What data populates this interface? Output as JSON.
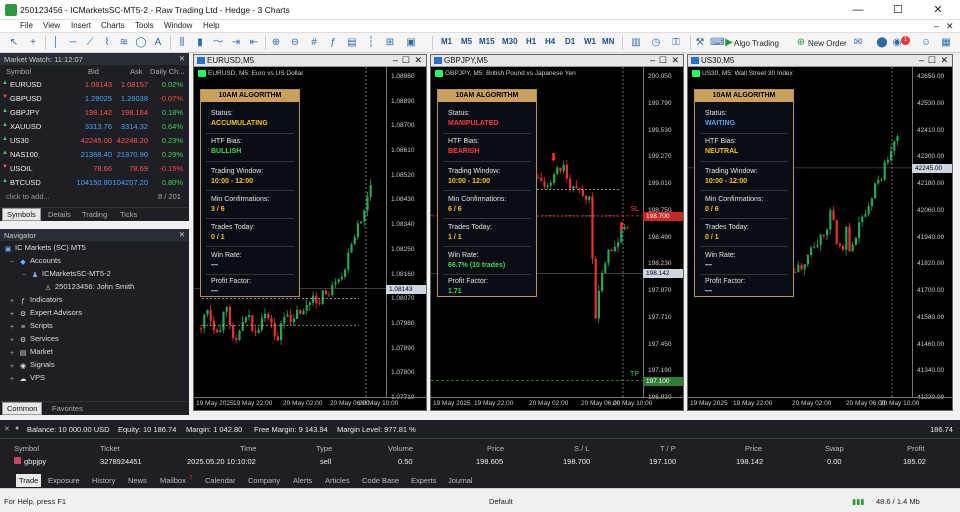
{
  "window": {
    "title": "250123456 - ICMarketsSC-MT5-2 - Raw Trading Ltd - Hedge - 3 Charts",
    "minimize": "—",
    "maximize": "☐",
    "close": "✕"
  },
  "menu": [
    "File",
    "View",
    "Insert",
    "Charts",
    "Tools",
    "Window",
    "Help"
  ],
  "toolbar": {
    "timeframes": [
      "M1",
      "M5",
      "M15",
      "M30",
      "H1",
      "H4",
      "D1",
      "W1",
      "MN"
    ],
    "algo_trading": "Algo Trading",
    "new_order": "New Order",
    "notifications": "1"
  },
  "market_watch": {
    "title": "Market Watch: 11:12:07",
    "headers": [
      "Symbol",
      "Bid",
      "Ask",
      "Daily Ch..."
    ],
    "rows": [
      {
        "symbol": "EURUSD",
        "bid": "1.08143",
        "ask": "1.08157",
        "change": "0.02%"
      },
      {
        "symbol": "GBPUSD",
        "bid": "1.29025",
        "ask": "1.29038",
        "change": "-0.07%"
      },
      {
        "symbol": "GBPJPY",
        "bid": "198.142",
        "ask": "198.164",
        "change": "0.18%"
      },
      {
        "symbol": "XAUUSD",
        "bid": "3313.76",
        "ask": "3314.32",
        "change": "0.64%"
      },
      {
        "symbol": "US30",
        "bid": "42245.00",
        "ask": "42248.20",
        "change": "0.23%"
      },
      {
        "symbol": "NAS100",
        "bid": "21368.40",
        "ask": "21370.90",
        "change": "0.29%"
      },
      {
        "symbol": "USOIL",
        "bid": "78.66",
        "ask": "78.69",
        "change": "-0.15%"
      },
      {
        "symbol": "BTCUSD",
        "bid": "104150.80",
        "ask": "104207.20",
        "change": "0.80%"
      }
    ],
    "add_text": "click to add...",
    "count": "8 / 201",
    "tabs": [
      "Symbols",
      "Details",
      "Trading",
      "Ticks"
    ]
  },
  "navigator": {
    "title": "Navigator",
    "items": [
      "IC Markets (SC) MT5",
      "Accounts",
      "ICMarketsSC-MT5-2",
      "250123456: John Smith",
      "Indicators",
      "Expert Advisors",
      "Scripts",
      "Services",
      "Market",
      "Signals",
      "VPS"
    ],
    "tabs": [
      "Common",
      "Favorites"
    ]
  },
  "charts": [
    {
      "window_title": "EURUSD,M5",
      "symbol_line": "EURUSD, M5:  Euro vs US Dollar",
      "prices": [
        "1.08980",
        "1.08890",
        "1.08700",
        "1.08610",
        "1.08520",
        "1.08430",
        "1.08340",
        "1.08250",
        "1.08160",
        "1.08070",
        "1.07980",
        "1.07890",
        "1.07800",
        "1.07710"
      ],
      "current": "1.08143",
      "times": [
        "19 May 2025",
        "19 May 22:00",
        "20 May 02:00",
        "20 May 06:00",
        "20 May 10:00"
      ],
      "status": "ACCUMULATING",
      "bias": "BULLISH",
      "window": "10:00 - 12:00",
      "confirm": "3 / 6",
      "trades": "0 / 1",
      "winrate": "—",
      "pf": "—"
    },
    {
      "window_title": "GBPJPY,M5",
      "symbol_line": "GBPJPY, M5:  British Pound vs Japanese Yen",
      "prices": [
        "200.050",
        "199.790",
        "199.530",
        "199.270",
        "199.010",
        "198.750",
        "198.490",
        "198.230",
        "197.970",
        "197.710",
        "197.450",
        "197.190",
        "196.930"
      ],
      "current": "198.142",
      "sl": "198.700",
      "tp": "197.100",
      "sl_label": "SL",
      "tp_label": "TP",
      "times": [
        "19 May 2025",
        "19 May 22:00",
        "20 May 02:00",
        "20 May 06:00",
        "20 May 10:00"
      ],
      "status": "MANIPULATED",
      "bias": "BEARISH",
      "window": "10:00 - 12:00",
      "confirm": "6 / 6",
      "trades": "1 / 1",
      "winrate": "66.7% (10 trades)",
      "pf": "1.71"
    },
    {
      "window_title": "US30,M5",
      "symbol_line": "US30, M5:  Wall Street 30 Index",
      "prices": [
        "42650.00",
        "42530.00",
        "42410.00",
        "42300.00",
        "42180.00",
        "42060.00",
        "41940.00",
        "41820.00",
        "41700.00",
        "41580.00",
        "41460.00",
        "41340.00",
        "41220.00"
      ],
      "current": "42245.00",
      "times": [
        "19 May 2025",
        "19 May 22:00",
        "20 May 02:00",
        "20 May 06:00",
        "20 May 10:00"
      ],
      "status": "WAITING",
      "bias": "NEUTRAL",
      "window": "10:00 - 12:00",
      "confirm": "0 / 6",
      "trades": "0 / 1",
      "winrate": "—",
      "pf": "—"
    }
  ],
  "algo_labels": {
    "header": "10AM ALGORITHM",
    "status": "Status:",
    "bias": "HTF Bias:",
    "window": "Trading Window:",
    "confirm": "Min Confirmations:",
    "trades": "Trades Today:",
    "winrate": "Win Rate:",
    "pf": "Profit Factor:"
  },
  "account": {
    "balance": "Balance: 10 000.00 USD",
    "equity": "Equity: 10 186.74",
    "margin": "Margin: 1 042.80",
    "free": "Free Margin: 9 143.94",
    "level": "Margin Level: 977.81 %",
    "profit_total": "186.74"
  },
  "trade": {
    "headers": [
      "Symbol",
      "Ticket",
      "Time",
      "Type",
      "Volume",
      "Price",
      "S / L",
      "T / P",
      "Price",
      "Swap",
      "Profit"
    ],
    "row": [
      "gbpjpy",
      "3278924451",
      "2025.05.20 10:10:02",
      "sell",
      "0.50",
      "198.605",
      "198.700",
      "197.100",
      "198.142",
      "0.00",
      "185.02"
    ]
  },
  "bottom_tabs": [
    "Trade",
    "Exposure",
    "History",
    "News",
    "Mailbox",
    "Calendar",
    "Company",
    "Alerts",
    "Articles",
    "Code Base",
    "Experts",
    "Journal"
  ],
  "mailbox_badge": "7",
  "status": {
    "help": "For Help, press F1",
    "profile": "Default",
    "traffic": "48.6 / 1.4 Mb"
  },
  "colors": {
    "bull": "#26a65b",
    "bear": "#e8322f",
    "accent": "#c9a05e",
    "panel": "#1d1f24"
  }
}
